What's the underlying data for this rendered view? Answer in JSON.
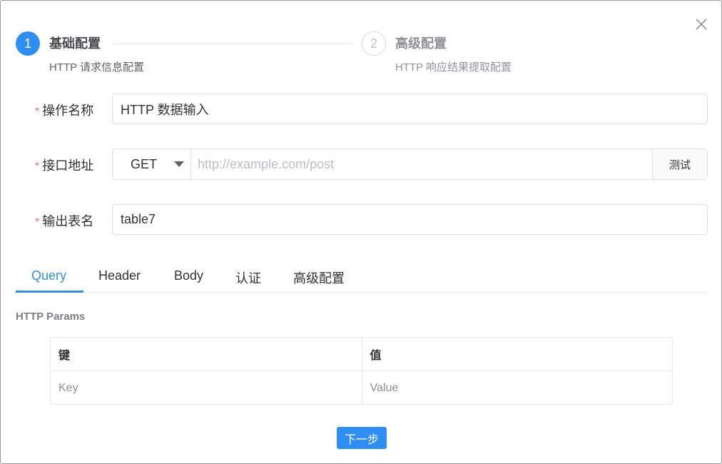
{
  "steps": [
    {
      "number": "1",
      "title": "基础配置",
      "description": "HTTP 请求信息配置"
    },
    {
      "number": "2",
      "title": "高级配置",
      "description": "HTTP 响应结果提取配置"
    }
  ],
  "form": {
    "required_mark": "*",
    "operation_name": {
      "label": "操作名称",
      "value": "HTTP 数据输入"
    },
    "endpoint": {
      "label": "接口地址",
      "method": "GET",
      "url_value": "",
      "url_placeholder": "http://example.com/post",
      "test_label": "测试"
    },
    "output_table": {
      "label": "输出表名",
      "value": "table7"
    }
  },
  "tabs": [
    {
      "label": "Query",
      "active": true
    },
    {
      "label": "Header",
      "active": false
    },
    {
      "label": "Body",
      "active": false
    },
    {
      "label": "认证",
      "active": false
    },
    {
      "label": "高级配置",
      "active": false
    }
  ],
  "params": {
    "title": "HTTP Params",
    "columns": [
      "键",
      "值"
    ],
    "placeholders": [
      "Key",
      "Value"
    ]
  },
  "footer": {
    "next_label": "下一步"
  },
  "icons": {
    "close": "close-icon",
    "dropdown": "caret-down-icon"
  },
  "colors": {
    "primary": "#2f8ef4",
    "required": "#f56c6c",
    "border": "#dcdfe6"
  }
}
